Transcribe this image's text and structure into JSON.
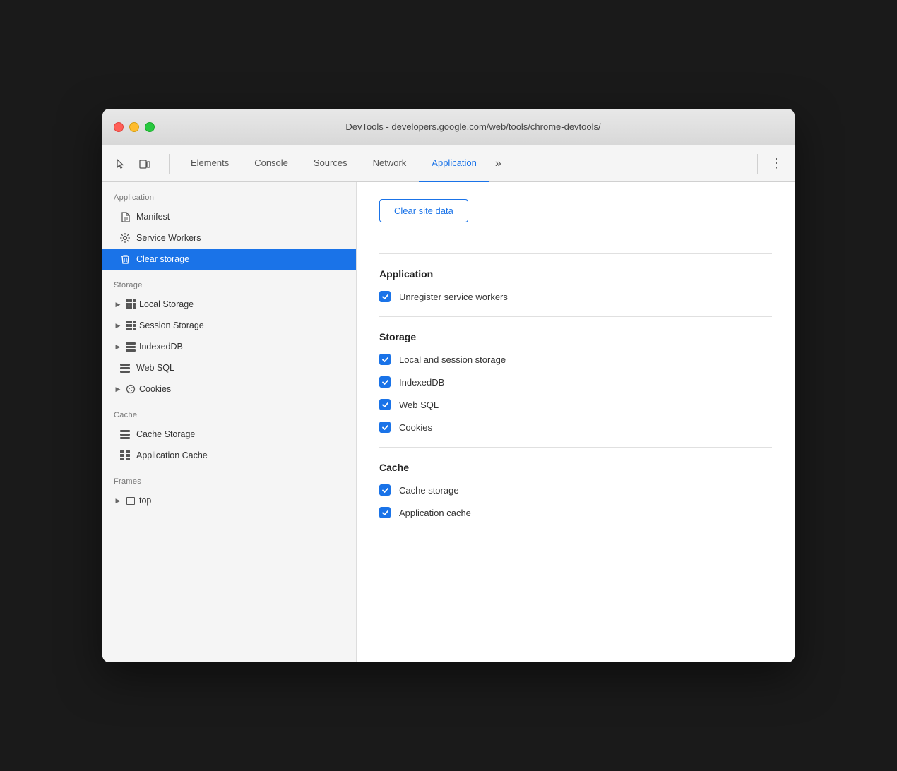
{
  "window": {
    "title": "DevTools - developers.google.com/web/tools/chrome-devtools/"
  },
  "toolbar": {
    "tabs": [
      {
        "id": "elements",
        "label": "Elements",
        "active": false
      },
      {
        "id": "console",
        "label": "Console",
        "active": false
      },
      {
        "id": "sources",
        "label": "Sources",
        "active": false
      },
      {
        "id": "network",
        "label": "Network",
        "active": false
      },
      {
        "id": "application",
        "label": "Application",
        "active": true
      }
    ],
    "more_label": "»",
    "menu_label": "⋮"
  },
  "sidebar": {
    "sections": [
      {
        "id": "application",
        "label": "Application",
        "items": [
          {
            "id": "manifest",
            "label": "Manifest",
            "icon": "file",
            "active": false,
            "has_arrow": false
          },
          {
            "id": "service-workers",
            "label": "Service Workers",
            "icon": "gear",
            "active": false,
            "has_arrow": false
          },
          {
            "id": "clear-storage",
            "label": "Clear storage",
            "icon": "trash",
            "active": true,
            "has_arrow": false
          }
        ]
      },
      {
        "id": "storage",
        "label": "Storage",
        "items": [
          {
            "id": "local-storage",
            "label": "Local Storage",
            "icon": "grid",
            "active": false,
            "has_arrow": true
          },
          {
            "id": "session-storage",
            "label": "Session Storage",
            "icon": "grid",
            "active": false,
            "has_arrow": true
          },
          {
            "id": "indexeddb",
            "label": "IndexedDB",
            "icon": "db",
            "active": false,
            "has_arrow": true
          },
          {
            "id": "web-sql",
            "label": "Web SQL",
            "icon": "db-stack",
            "active": false,
            "has_arrow": false
          },
          {
            "id": "cookies",
            "label": "Cookies",
            "icon": "cookie",
            "active": false,
            "has_arrow": true
          }
        ]
      },
      {
        "id": "cache",
        "label": "Cache",
        "items": [
          {
            "id": "cache-storage",
            "label": "Cache Storage",
            "icon": "db-stack",
            "active": false,
            "has_arrow": false
          },
          {
            "id": "app-cache",
            "label": "Application Cache",
            "icon": "grid2",
            "active": false,
            "has_arrow": false
          }
        ]
      },
      {
        "id": "frames",
        "label": "Frames",
        "items": [
          {
            "id": "top",
            "label": "top",
            "icon": "frame",
            "active": false,
            "has_arrow": true
          }
        ]
      }
    ]
  },
  "content": {
    "clear_button_label": "Clear site data",
    "sections": [
      {
        "id": "application",
        "title": "Application",
        "items": [
          {
            "id": "unregister-sw",
            "label": "Unregister service workers",
            "checked": true
          }
        ]
      },
      {
        "id": "storage",
        "title": "Storage",
        "items": [
          {
            "id": "local-session",
            "label": "Local and session storage",
            "checked": true
          },
          {
            "id": "indexeddb",
            "label": "IndexedDB",
            "checked": true
          },
          {
            "id": "web-sql",
            "label": "Web SQL",
            "checked": true
          },
          {
            "id": "cookies",
            "label": "Cookies",
            "checked": true
          }
        ]
      },
      {
        "id": "cache",
        "title": "Cache",
        "items": [
          {
            "id": "cache-storage",
            "label": "Cache storage",
            "checked": true
          },
          {
            "id": "app-cache",
            "label": "Application cache",
            "checked": true
          }
        ]
      }
    ]
  },
  "colors": {
    "accent": "#1a73e8",
    "active_bg": "#1a73e8",
    "checkbox_bg": "#1a73e8"
  }
}
